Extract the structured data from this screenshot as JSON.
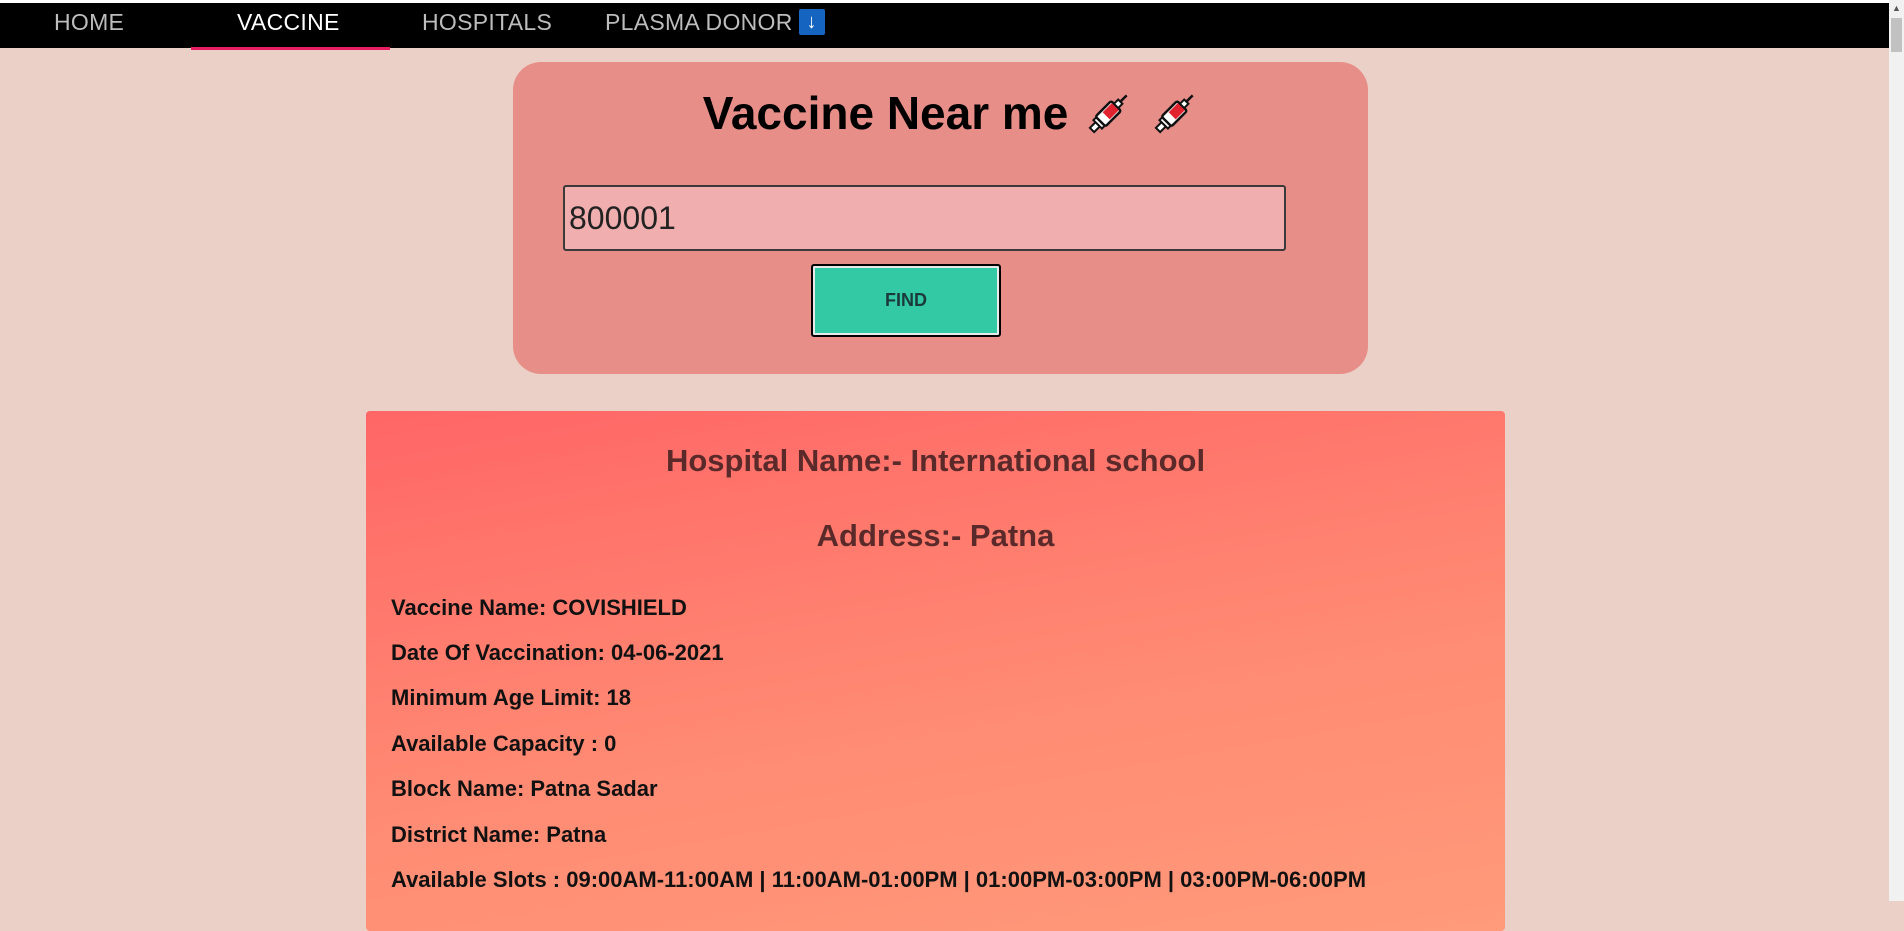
{
  "nav": {
    "items": [
      {
        "label": "HOME"
      },
      {
        "label": "VACCINE",
        "active": true
      },
      {
        "label": "HOSPITALS"
      },
      {
        "label": "PLASMA DONOR",
        "badge_glyph": "↓"
      }
    ]
  },
  "search": {
    "title": "Vaccine Near me",
    "title_icons": [
      "syringe-icon",
      "syringe-icon"
    ],
    "pincode_value": "800001",
    "find_label": "FIND"
  },
  "result": {
    "hospital_name": "Hospital Name:- International school",
    "address": "Address:- Patna",
    "details": [
      "Vaccine Name: COVISHIELD",
      "Date Of Vaccination: 04-06-2021",
      "Minimum Age Limit: 18",
      "Available Capacity : 0",
      "Block Name: Patna Sadar",
      "District Name: Patna",
      "Available Slots : 09:00AM-11:00AM | 11:00AM-01:00PM | 01:00PM-03:00PM | 03:00PM-06:00PM"
    ]
  },
  "colors": {
    "page_bg": "#ead0c6",
    "navbar_bg": "#000000",
    "active_underline": "#e91e63",
    "search_card_bg": "#e88e88",
    "input_bg": "#f0aeae",
    "find_button_bg": "#34c9a5",
    "result_gradient_top": "#ff6666",
    "result_gradient_bottom": "#ff9a7a"
  }
}
